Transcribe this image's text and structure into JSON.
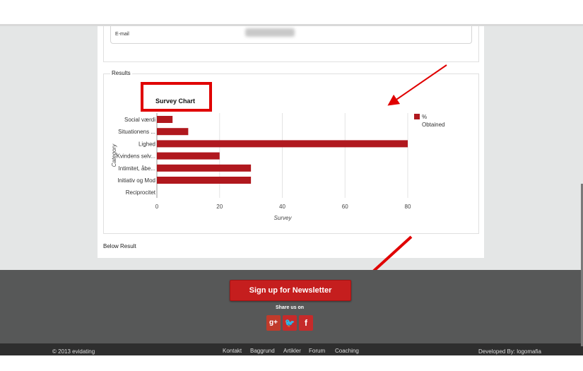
{
  "form": {
    "email_label": "E-mail"
  },
  "results": {
    "legend": "Results",
    "below": "Below Result"
  },
  "chart_data": {
    "type": "bar",
    "orientation": "horizontal",
    "title": "Survey Chart",
    "xlabel": "Survey",
    "ylabel": "Category",
    "categories": [
      "Social værdi",
      "Situationens ...",
      "Lighed",
      "Kvindens selv...",
      "Intimitet, åbe...",
      "Initiativ og Mod",
      "Reciprocitet"
    ],
    "series": [
      {
        "name": "% Obtained",
        "values": [
          5,
          10,
          80,
          20,
          30,
          30,
          0
        ]
      }
    ],
    "xticks": [
      "0",
      "20",
      "40",
      "60",
      "80"
    ],
    "xlim": [
      0,
      80
    ],
    "grid": true,
    "legend_position": "right",
    "bar_color": "#b0181e"
  },
  "footer": {
    "newsletter_button": "Sign up for Newsletter",
    "share_label": "Share us on",
    "social": [
      {
        "icon": "google-plus-icon",
        "glyph": "g+"
      },
      {
        "icon": "twitter-icon",
        "glyph": "🐦"
      },
      {
        "icon": "facebook-icon",
        "glyph": "f"
      }
    ],
    "copyright": "© 2013 evidating",
    "links": [
      "Kontakt",
      "Baggrund",
      "Artikler",
      "Forum",
      "Coaching"
    ],
    "developed_by": "Developed By: logomafia"
  },
  "annotation_color": "#e00000"
}
